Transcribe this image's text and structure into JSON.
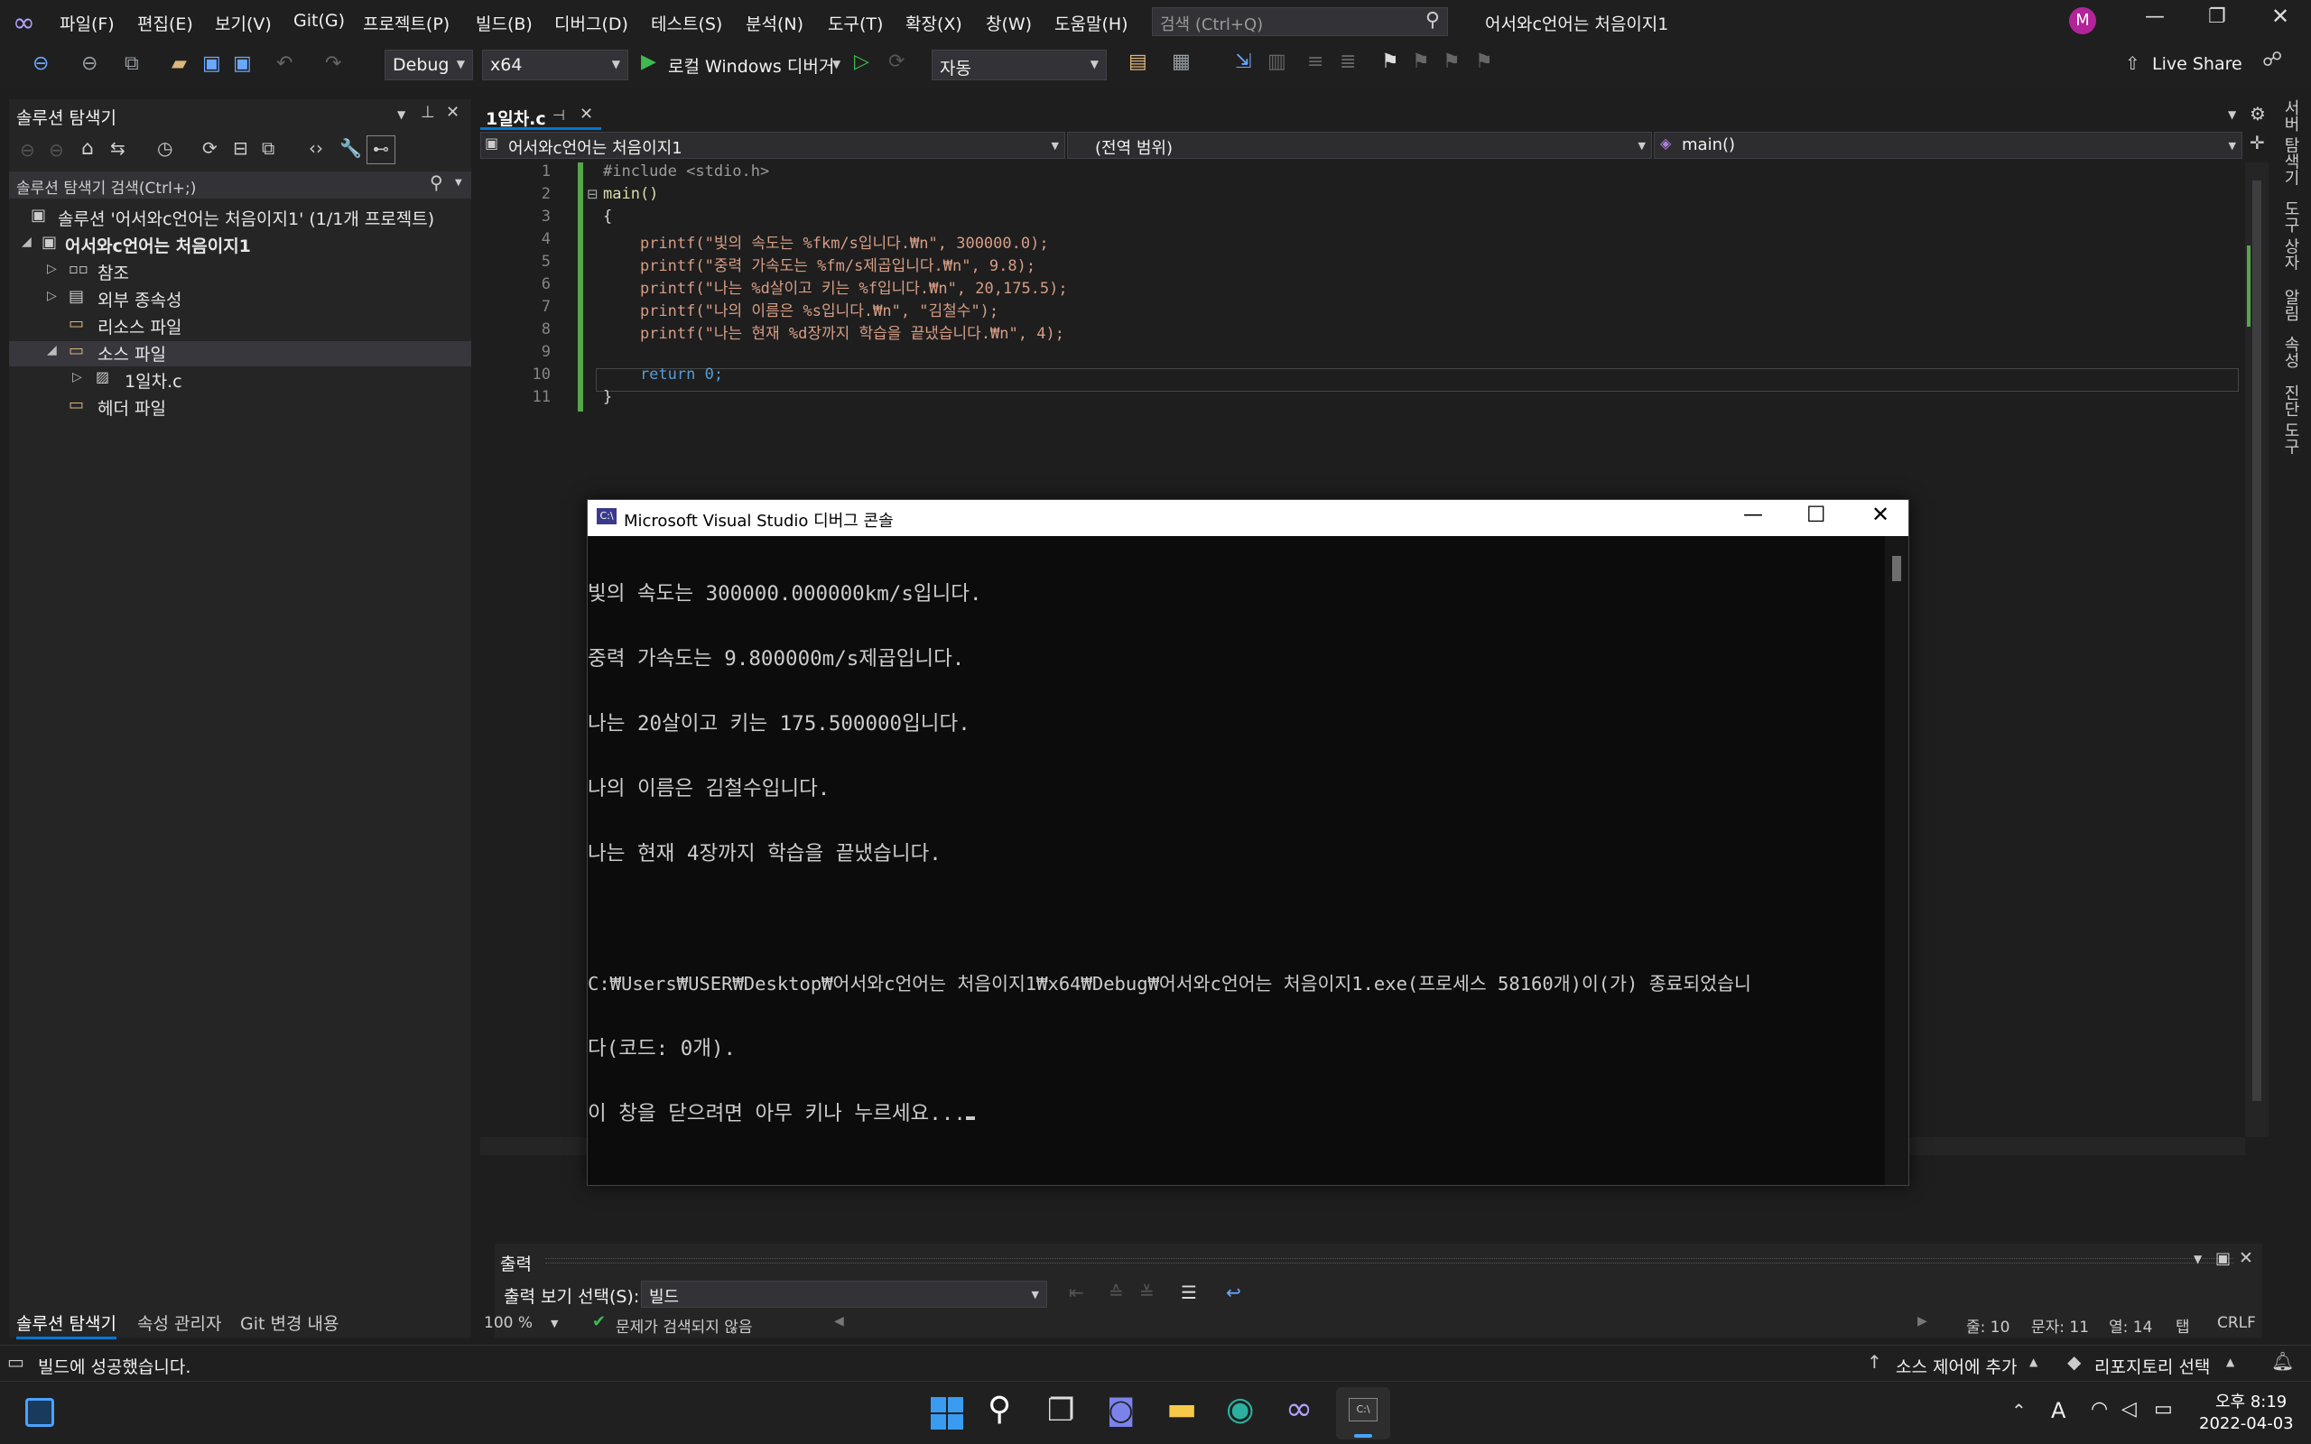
{
  "menubar": {
    "items": [
      "파일(F)",
      "편집(E)",
      "보기(V)",
      "Git(G)",
      "프로젝트(P)",
      "빌드(B)",
      "디버그(D)",
      "테스트(S)",
      "분석(N)",
      "도구(T)",
      "확장(X)",
      "창(W)",
      "도움말(H)"
    ],
    "search_placeholder": "검색 (Ctrl+Q)",
    "window_title": "어서와c언어는 처음이지1",
    "avatar_letter": "M"
  },
  "toolbar": {
    "config": "Debug",
    "platform": "x64",
    "run_label": "로컬 Windows 디버거",
    "auto": "자동",
    "live_share": "Live Share"
  },
  "solution_explorer": {
    "title": "솔루션 탐색기",
    "search_placeholder": "솔루션 탐색기 검색(Ctrl+;)",
    "solution": "솔루션 '어서와c언어는 처음이지1' (1/1개 프로젝트)",
    "project": "어서와c언어는 처음이지1",
    "nodes": [
      "참조",
      "외부 종속성",
      "리소스 파일",
      "소스 파일",
      "1일차.c",
      "헤더 파일"
    ],
    "bottom_tabs": [
      "솔루션 탐색기",
      "속성 관리자",
      "Git 변경 내용"
    ]
  },
  "editor": {
    "tab": "1일차.c",
    "nav_project": "어서와c언어는 처음이지1",
    "nav_scope": "(전역 범위)",
    "nav_member": "main()",
    "lines": [
      "#include <stdio.h>",
      "main()",
      "{",
      "    printf(\"빛의 속도는 %fkm/s입니다.₩n\", 300000.0);",
      "    printf(\"중력 가속도는 %fm/s제곱입니다.₩n\", 9.8);",
      "    printf(\"나는 %d살이고 키는 %f입니다.₩n\", 20,175.5);",
      "    printf(\"나의 이름은 %s입니다.₩n\", \"김철수\");",
      "    printf(\"나는 현재 %d장까지 학습을 끝냈습니다.₩n\", 4);",
      "",
      "    return 0;",
      "}"
    ],
    "line_numbers": [
      "1",
      "2",
      "3",
      "4",
      "5",
      "6",
      "7",
      "8",
      "9",
      "10",
      "11"
    ],
    "zoom": "100 %",
    "issues": "문제가 검색되지 않음",
    "pos_line": "줄: 10",
    "pos_char": "문자: 11",
    "pos_col": "열: 14",
    "tab_mode": "탭",
    "eol": "CRLF"
  },
  "console": {
    "title": "Microsoft Visual Studio 디버그 콘솔",
    "lines": [
      "빛의 속도는 300000.000000km/s입니다.",
      "중력 가속도는 9.800000m/s제곱입니다.",
      "나는 20살이고 키는 175.500000입니다.",
      "나의 이름은 김철수입니다.",
      "나는 현재 4장까지 학습을 끝냈습니다.",
      "",
      "C:₩Users₩USER₩Desktop₩어서와c언어는 처음이지1₩x64₩Debug₩어서와c언어는 처음이지1.exe(프로세스 58160개)이(가) 종료되었습니",
      "다(코드: 0개).",
      "이 창을 닫으려면 아무 키나 누르세요..."
    ]
  },
  "output_panel": {
    "title": "출력",
    "select_label": "출력 보기 선택(S):",
    "select_value": "빌드"
  },
  "right_side_tabs": [
    "서버 탐색기",
    "도구 상자",
    "알림",
    "속성",
    "진단 도구"
  ],
  "statusbar": {
    "message": "빌드에 성공했습니다.",
    "source_control": "소스 제어에 추가",
    "repo": "리포지토리 선택"
  },
  "taskbar": {
    "time": "오후 8:19",
    "date": "2022-04-03",
    "ime": "A"
  }
}
